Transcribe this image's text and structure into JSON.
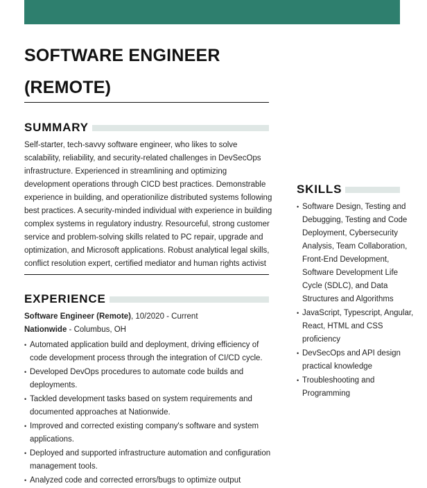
{
  "header": {
    "accent_color": "#2e7f6e",
    "title_line1": "SOFTWARE ENGINEER",
    "title_line2": "(REMOTE)"
  },
  "summary": {
    "heading": "SUMMARY",
    "text": "Self-starter, tech-savvy software engineer, who likes to solve scalability, reliability, and security-related challenges in DevSecOps infrastructure. Experienced in streamlining and optimizing development operations through CICD best practices. Demonstrable experience in building, and operationilize distributed systems following best practices. A security-minded individual with experience in building complex systems in regulatory industry. Resourceful, strong customer service and problem-solving skills related to PC repair, upgrade and optimization, and Microsoft applications. Robust analytical legal skills, conflict resolution expert, certified mediator and human rights activist"
  },
  "experience": {
    "heading": "EXPERIENCE",
    "jobs": [
      {
        "title": "Software Engineer (Remote)",
        "dates": ", 10/2020 - Current",
        "company": "Nationwide",
        "location": " - Columbus, OH",
        "bullets": [
          "Automated application build and deployment, driving efficiency of code development process through the integration of CI/CD cycle.",
          "Developed DevOps procedures to automate code builds and deployments.",
          "Tackled development tasks based on system requirements and documented approaches at Nationwide.",
          "Improved and corrected existing company's software and system applications.",
          "Deployed and supported infrastructure automation and configuration management tools.",
          "Analyzed code and corrected errors/bugs to optimize output"
        ]
      }
    ]
  },
  "skills": {
    "heading": "SKILLS",
    "items": [
      "Software Design, Testing and Debugging, Testing and Code Deployment, Cybersecurity Analysis, Team Collaboration, Front-End Development, Software Development Life Cycle (SDLC), and Data Structures and Algorithms",
      "JavaScript, Typescript, Angular, React, HTML and CSS proficiency",
      "DevSecOps and API design practical knowledge",
      "Troubleshooting and Programming"
    ]
  }
}
